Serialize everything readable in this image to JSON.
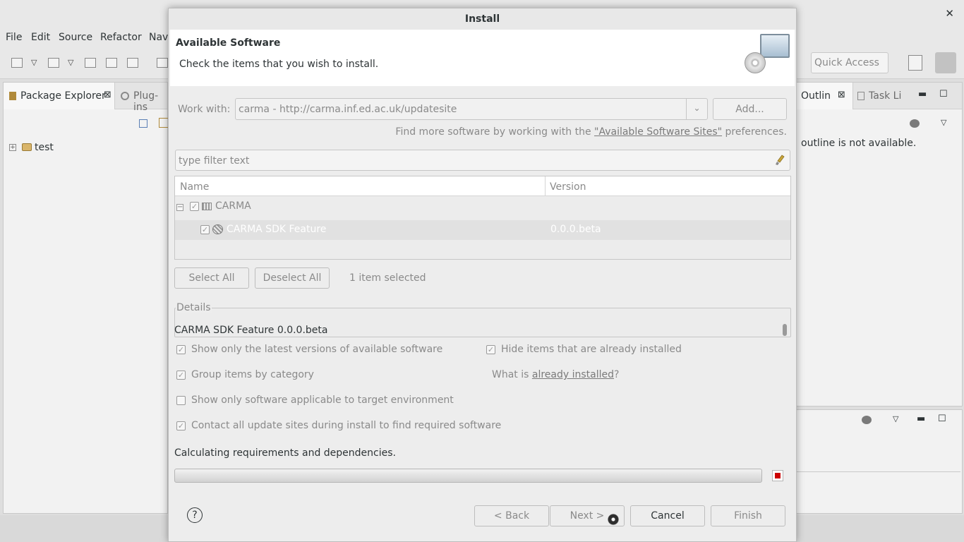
{
  "background": {
    "menu": [
      "File",
      "Edit",
      "Source",
      "Refactor",
      "Nav"
    ],
    "quick_access_placeholder": "Quick Access",
    "package_explorer": {
      "tab_label": "Package Explorer",
      "other_tab_label": "Plug-ins",
      "tree_items": [
        "test"
      ]
    },
    "outline": {
      "tab_label": "Outlin",
      "other_tab_label": "Task Li",
      "message": "outline is not available."
    },
    "close_glyph": "✕",
    "tab_close_glyph": "⊠",
    "minimize_glyph": "▬",
    "maximize_glyph": "☐",
    "dropdown_glyph": "▽"
  },
  "dialog": {
    "title": "Install",
    "header": {
      "title": "Available Software",
      "description": "Check the items that you wish to install."
    },
    "work_with": {
      "label": "Work with:",
      "value": "carma - http://carma.inf.ed.ac.uk/updatesite",
      "add_label": "Add..."
    },
    "find_more": {
      "prefix": "Find more software by working with the ",
      "link": "\"Available Software Sites\"",
      "suffix": " preferences."
    },
    "filter_placeholder": "type filter text",
    "table": {
      "columns": [
        "Name",
        "Version"
      ],
      "rows": [
        {
          "name": "CARMA",
          "version": "",
          "checked": true,
          "expanded": true,
          "level": 0
        },
        {
          "name": "CARMA SDK Feature",
          "version": "0.0.0.beta",
          "checked": true,
          "level": 1,
          "selected": true
        }
      ]
    },
    "select_all_label": "Select All",
    "deselect_all_label": "Deselect All",
    "selected_count": "1 item selected",
    "details": {
      "legend": "Details",
      "text": "CARMA SDK Feature 0.0.0.beta"
    },
    "options": {
      "latest": {
        "label": "Show only the latest versions of available software",
        "checked": true
      },
      "group": {
        "label": "Group items by category",
        "checked": true
      },
      "target": {
        "label": "Show only software applicable to target environment",
        "checked": false
      },
      "contact": {
        "label": "Contact all update sites during install to find required software",
        "checked": true
      },
      "hide_installed": {
        "label": "Hide items that are already installed",
        "checked": true
      }
    },
    "what_is": {
      "prefix": "What is ",
      "link": "already installed",
      "suffix": "?"
    },
    "status": "Calculating requirements and dependencies.",
    "buttons": {
      "help": "?",
      "back": "< Back",
      "next": "Next >",
      "cancel": "Cancel",
      "finish": "Finish"
    },
    "check_glyph": "✓",
    "collapse_glyph": "−",
    "expand_glyph": "+",
    "dropdown_glyph": "⌄"
  }
}
